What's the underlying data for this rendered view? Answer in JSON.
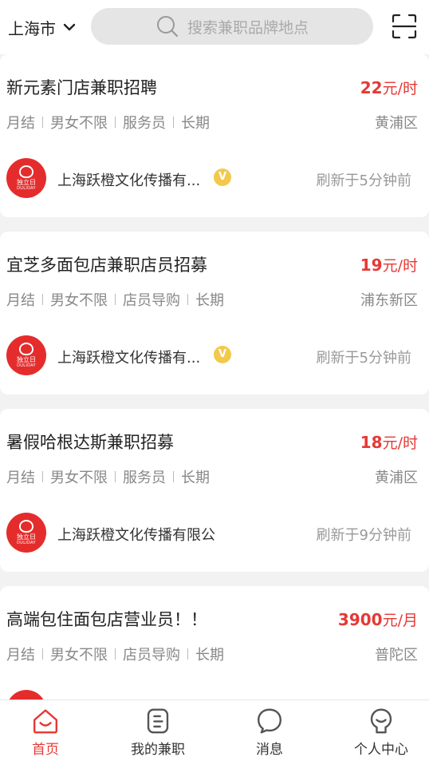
{
  "header": {
    "city": "上海市",
    "search_placeholder": "搜索兼职品牌地点",
    "icons": {
      "city_dropdown": "chevron-down-icon",
      "search": "search-icon",
      "scan": "scan-icon"
    }
  },
  "jobs": [
    {
      "title": "新元素门店兼职招聘",
      "salary_amount": "22",
      "salary_unit": "元/时",
      "tags": [
        "月结",
        "男女不限",
        "服务员",
        "长期"
      ],
      "district": "黄浦区",
      "company": "上海跃橙文化传播有...",
      "verified_badge": "V",
      "refreshed": "刷新于5分钟前"
    },
    {
      "title": " 宜芝多面包店兼职店员招募",
      "salary_amount": "19",
      "salary_unit": "元/时",
      "tags": [
        "月结",
        "男女不限",
        "店员导购",
        "长期"
      ],
      "district": "浦东新区",
      "company": "上海跃橙文化传播有...",
      "verified_badge": "V",
      "refreshed": "刷新于5分钟前"
    },
    {
      "title": "暑假哈根达斯兼职招募",
      "salary_amount": "18",
      "salary_unit": "元/时",
      "tags": [
        "月结",
        "男女不限",
        "服务员",
        "长期"
      ],
      "district": "黄浦区",
      "company": "上海跃橙文化传播有限公",
      "verified_badge": "",
      "refreshed": "刷新于9分钟前"
    },
    {
      "title": "高端包住面包店营业员！！",
      "salary_amount": "3900",
      "salary_unit": "元/月",
      "tags": [
        "月结",
        "男女不限",
        "店员导购",
        "长期"
      ],
      "district": "普陀区",
      "company": "",
      "verified_badge": "",
      "refreshed": ""
    }
  ],
  "company_logo": {
    "line1": "独立日",
    "line2": "DULIDAY"
  },
  "tabbar": {
    "items": [
      {
        "label": "首页",
        "icon": "home-icon",
        "active": true
      },
      {
        "label": "我的兼职",
        "icon": "my-jobs-icon",
        "active": false
      },
      {
        "label": "消息",
        "icon": "message-icon",
        "active": false
      },
      {
        "label": "个人中心",
        "icon": "profile-icon",
        "active": false
      }
    ]
  },
  "colors": {
    "accent": "#e53935",
    "logo_red": "#e52c2c",
    "badge_gold": "#f2c94c"
  }
}
